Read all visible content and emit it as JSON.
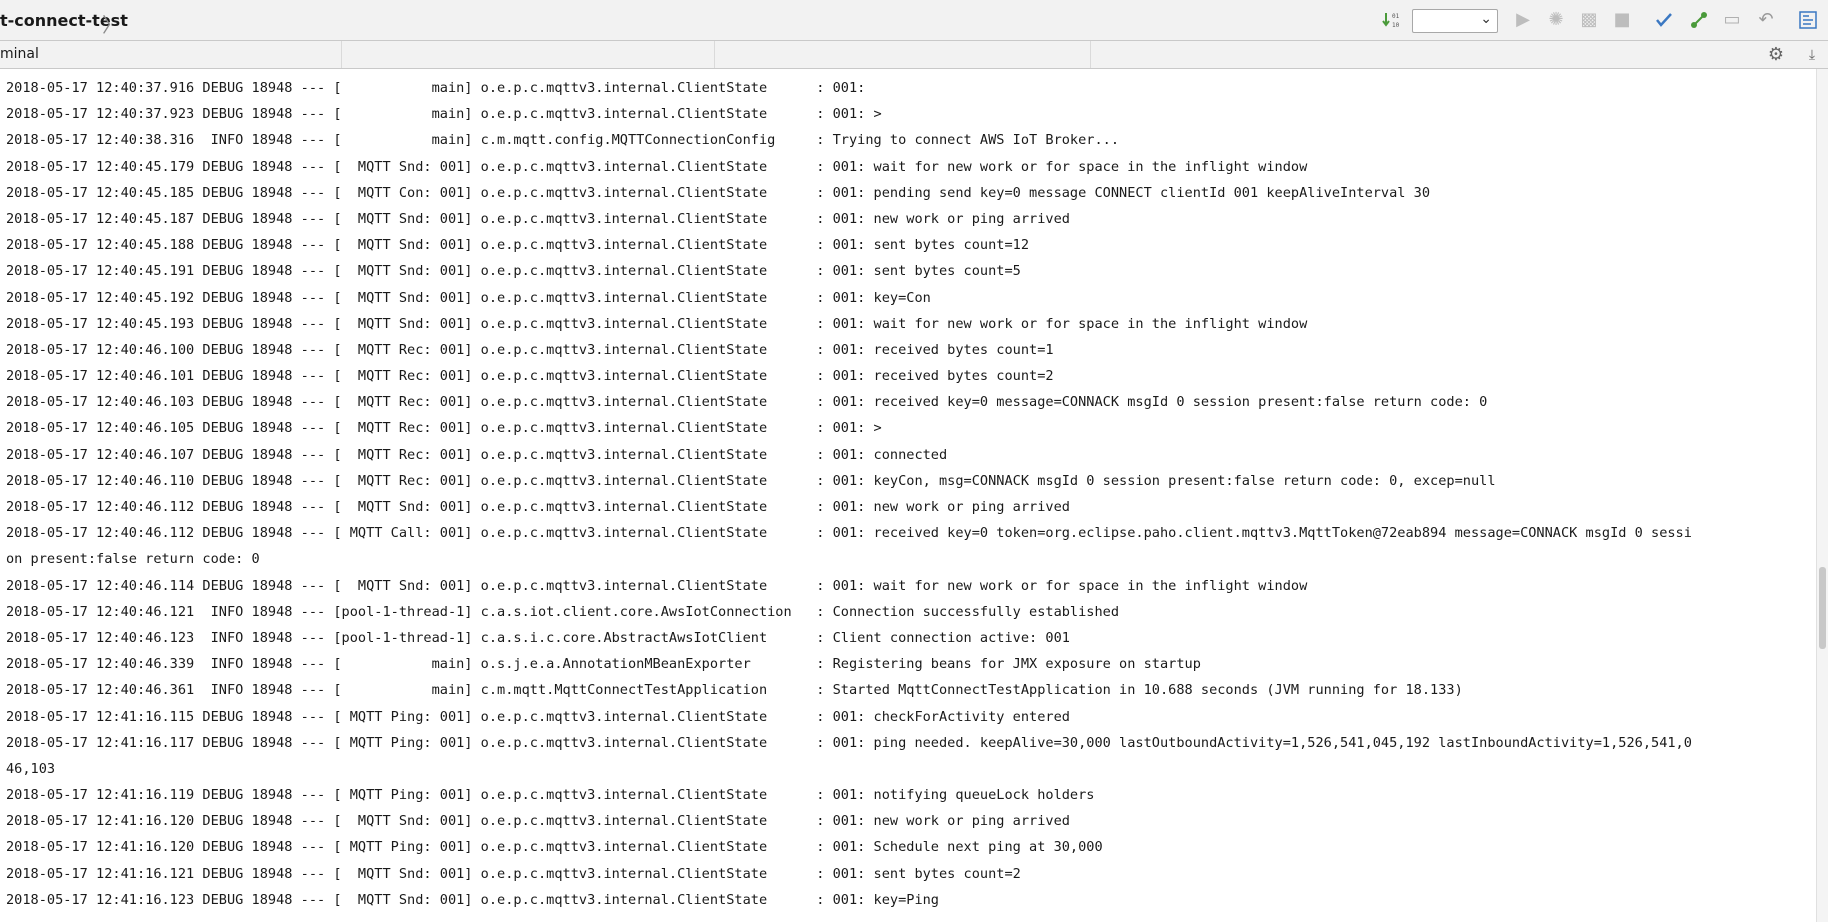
{
  "toolbar": {
    "project_title": "t-connect-test",
    "run_config_value": "",
    "icons": [
      "sort-icon",
      "run-icon",
      "debug-icon",
      "coverage-icon",
      "stop-icon",
      "vcs-update-icon",
      "vcs-commit-icon",
      "vcs-compare-icon",
      "vcs-revert-icon",
      "structure-icon"
    ]
  },
  "panel": {
    "tab_label": "minal",
    "icons": [
      "gear-icon",
      "hide-panel-icon"
    ]
  },
  "console": {
    "lines": [
      "2018-05-17 12:40:37.916 DEBUG 18948 --- [           main] o.e.p.c.mqttv3.internal.ClientState      : 001:",
      "2018-05-17 12:40:37.923 DEBUG 18948 --- [           main] o.e.p.c.mqttv3.internal.ClientState      : 001: >",
      "2018-05-17 12:40:38.316  INFO 18948 --- [           main] c.m.mqtt.config.MQTTConnectionConfig     : Trying to connect AWS IoT Broker...",
      "2018-05-17 12:40:45.179 DEBUG 18948 --- [  MQTT Snd: 001] o.e.p.c.mqttv3.internal.ClientState      : 001: wait for new work or for space in the inflight window",
      "2018-05-17 12:40:45.185 DEBUG 18948 --- [  MQTT Con: 001] o.e.p.c.mqttv3.internal.ClientState      : 001: pending send key=0 message CONNECT clientId 001 keepAliveInterval 30",
      "2018-05-17 12:40:45.187 DEBUG 18948 --- [  MQTT Snd: 001] o.e.p.c.mqttv3.internal.ClientState      : 001: new work or ping arrived",
      "2018-05-17 12:40:45.188 DEBUG 18948 --- [  MQTT Snd: 001] o.e.p.c.mqttv3.internal.ClientState      : 001: sent bytes count=12",
      "2018-05-17 12:40:45.191 DEBUG 18948 --- [  MQTT Snd: 001] o.e.p.c.mqttv3.internal.ClientState      : 001: sent bytes count=5",
      "2018-05-17 12:40:45.192 DEBUG 18948 --- [  MQTT Snd: 001] o.e.p.c.mqttv3.internal.ClientState      : 001: key=Con",
      "2018-05-17 12:40:45.193 DEBUG 18948 --- [  MQTT Snd: 001] o.e.p.c.mqttv3.internal.ClientState      : 001: wait for new work or for space in the inflight window",
      "2018-05-17 12:40:46.100 DEBUG 18948 --- [  MQTT Rec: 001] o.e.p.c.mqttv3.internal.ClientState      : 001: received bytes count=1",
      "2018-05-17 12:40:46.101 DEBUG 18948 --- [  MQTT Rec: 001] o.e.p.c.mqttv3.internal.ClientState      : 001: received bytes count=2",
      "2018-05-17 12:40:46.103 DEBUG 18948 --- [  MQTT Rec: 001] o.e.p.c.mqttv3.internal.ClientState      : 001: received key=0 message=CONNACK msgId 0 session present:false return code: 0",
      "2018-05-17 12:40:46.105 DEBUG 18948 --- [  MQTT Rec: 001] o.e.p.c.mqttv3.internal.ClientState      : 001: >",
      "2018-05-17 12:40:46.107 DEBUG 18948 --- [  MQTT Rec: 001] o.e.p.c.mqttv3.internal.ClientState      : 001: connected",
      "2018-05-17 12:40:46.110 DEBUG 18948 --- [  MQTT Rec: 001] o.e.p.c.mqttv3.internal.ClientState      : 001: keyCon, msg=CONNACK msgId 0 session present:false return code: 0, excep=null",
      "2018-05-17 12:40:46.112 DEBUG 18948 --- [  MQTT Snd: 001] o.e.p.c.mqttv3.internal.ClientState      : 001: new work or ping arrived",
      "2018-05-17 12:40:46.112 DEBUG 18948 --- [ MQTT Call: 001] o.e.p.c.mqttv3.internal.ClientState      : 001: received key=0 token=org.eclipse.paho.client.mqttv3.MqttToken@72eab894 message=CONNACK msgId 0 sessi",
      "on present:false return code: 0",
      "2018-05-17 12:40:46.114 DEBUG 18948 --- [  MQTT Snd: 001] o.e.p.c.mqttv3.internal.ClientState      : 001: wait for new work or for space in the inflight window",
      "2018-05-17 12:40:46.121  INFO 18948 --- [pool-1-thread-1] c.a.s.iot.client.core.AwsIotConnection   : Connection successfully established",
      "2018-05-17 12:40:46.123  INFO 18948 --- [pool-1-thread-1] c.a.s.i.c.core.AbstractAwsIotClient      : Client connection active: 001",
      "2018-05-17 12:40:46.339  INFO 18948 --- [           main] o.s.j.e.a.AnnotationMBeanExporter        : Registering beans for JMX exposure on startup",
      "2018-05-17 12:40:46.361  INFO 18948 --- [           main] c.m.mqtt.MqttConnectTestApplication      : Started MqttConnectTestApplication in 10.688 seconds (JVM running for 18.133)",
      "2018-05-17 12:41:16.115 DEBUG 18948 --- [ MQTT Ping: 001] o.e.p.c.mqttv3.internal.ClientState      : 001: checkForActivity entered",
      "2018-05-17 12:41:16.117 DEBUG 18948 --- [ MQTT Ping: 001] o.e.p.c.mqttv3.internal.ClientState      : 001: ping needed. keepAlive=30,000 lastOutboundActivity=1,526,541,045,192 lastInboundActivity=1,526,541,0",
      "46,103",
      "2018-05-17 12:41:16.119 DEBUG 18948 --- [ MQTT Ping: 001] o.e.p.c.mqttv3.internal.ClientState      : 001: notifying queueLock holders",
      "2018-05-17 12:41:16.120 DEBUG 18948 --- [  MQTT Snd: 001] o.e.p.c.mqttv3.internal.ClientState      : 001: new work or ping arrived",
      "2018-05-17 12:41:16.120 DEBUG 18948 --- [ MQTT Ping: 001] o.e.p.c.mqttv3.internal.ClientState      : 001: Schedule next ping at 30,000",
      "2018-05-17 12:41:16.121 DEBUG 18948 --- [  MQTT Snd: 001] o.e.p.c.mqttv3.internal.ClientState      : 001: sent bytes count=2",
      "2018-05-17 12:41:16.123 DEBUG 18948 --- [  MQTT Snd: 001] o.e.p.c.mqttv3.internal.ClientState      : 001: key=Ping"
    ]
  },
  "colors": {
    "toolbar_bg": "#f2f2f2",
    "console_bg": "#ffffff",
    "text": "#1a1a1a",
    "accent_blue": "#3b78c2",
    "accent_green": "#4a9a3a"
  }
}
